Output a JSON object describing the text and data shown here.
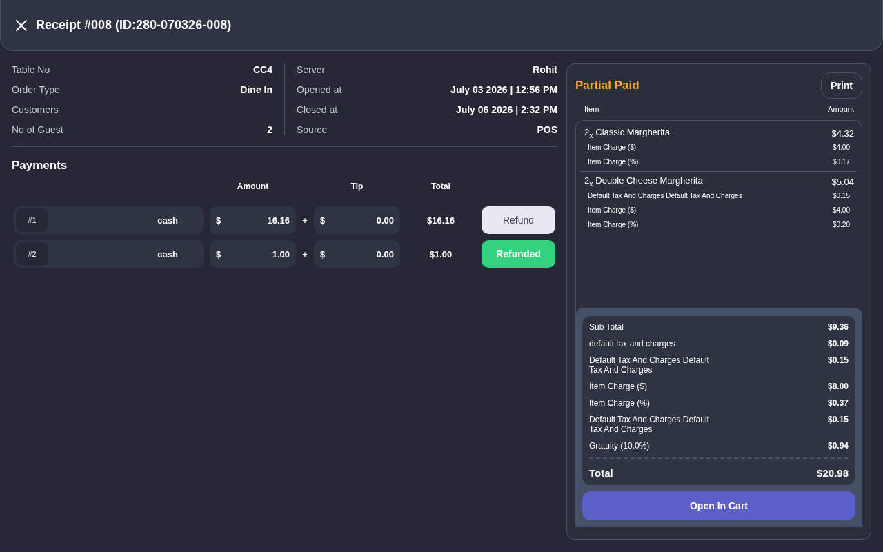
{
  "header": {
    "title": "Receipt #008 (ID:280-070326-008)"
  },
  "order_details": {
    "left": [
      {
        "label": "Table No",
        "value": "CC4"
      },
      {
        "label": "Order Type",
        "value": "Dine In"
      },
      {
        "label": "Customers"
      },
      {
        "label": "No of Guest",
        "value": "2"
      }
    ],
    "right": [
      {
        "label": "Server",
        "value": "Rohit"
      },
      {
        "label": "Opened at",
        "value": "July 03 2026 | 12:56 PM"
      },
      {
        "label": "Closed at",
        "value": "July 06 2026 | 2:32 PM"
      },
      {
        "label": "Source",
        "value": "POS"
      }
    ]
  },
  "payments": {
    "title": "Payments",
    "columns": [
      "Amount",
      "Tip",
      "Total"
    ],
    "rows": [
      {
        "number": "#1",
        "method": "cash",
        "currency": "$",
        "amount": "16.16",
        "operator": "+",
        "tip_currency": "$",
        "tip": "0.00",
        "total": "$16.16",
        "action": "Refund",
        "refunded": false
      },
      {
        "number": "#2",
        "method": "cash",
        "currency": "$",
        "amount": "1.00",
        "operator": "+",
        "tip_currency": "$",
        "tip": "0.00",
        "total": "$1.00",
        "action": "Refunded",
        "refunded": true
      }
    ]
  },
  "receipt": {
    "status": "Partial Paid",
    "print_button": "Print",
    "columns": [
      "Item",
      "Amount"
    ],
    "items": [
      {
        "name": "2$_{x}$ Classic Margherita",
        "amount": "$4.32",
        "modifiers": [
          {
            "label": "Item Charge ($)",
            "amount": "$4.00"
          },
          {
            "label": "Item Charge (%)",
            "amount": "$0.17"
          }
        ]
      },
      {
        "name": "2$_{x}$ Double Cheese Margherita",
        "amount": "$5.04",
        "modifiers": [
          {
            "label": "Default Tax And Charges Default Tax And Charges",
            "amount": "$0.15"
          },
          {
            "label": "Item Charge ($)",
            "amount": "$4.00"
          },
          {
            "label": "Item Charge (%)",
            "amount": "$0.20"
          }
        ]
      }
    ],
    "summary": [
      {
        "label": "Sub Total",
        "amount": "$9.36"
      },
      {
        "label": "default tax and charges",
        "amount": "$0.09"
      },
      {
        "label": "Default Tax And Charges Default Tax And Charges",
        "amount": "$0.15"
      },
      {
        "label": "Item Charge ($)",
        "amount": "$8.00"
      },
      {
        "label": "Item Charge (%)",
        "amount": "$0.37"
      },
      {
        "label": "Default Tax And Charges Default Tax And Charges",
        "amount": "$0.15"
      },
      {
        "label": "Gratuity (10.0%)",
        "amount": "$0.94"
      }
    ],
    "total": {
      "label": "Total",
      "amount": "$20.98"
    },
    "action_button": "Open In Cart"
  }
}
